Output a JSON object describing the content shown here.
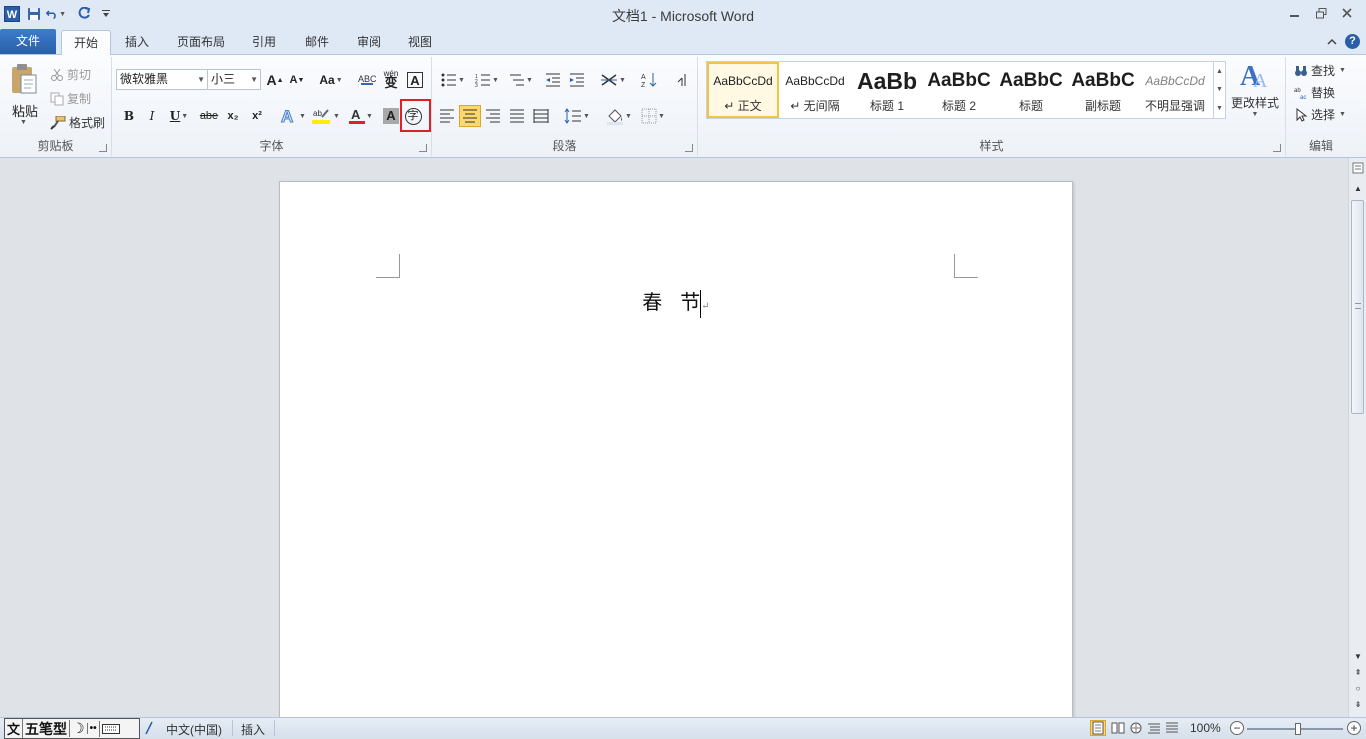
{
  "window": {
    "title": "文档1 - Microsoft Word",
    "app_icon_letter": "W"
  },
  "tabs": [
    {
      "label": "文件"
    },
    {
      "label": "开始"
    },
    {
      "label": "插入"
    },
    {
      "label": "页面布局"
    },
    {
      "label": "引用"
    },
    {
      "label": "邮件"
    },
    {
      "label": "审阅"
    },
    {
      "label": "视图"
    }
  ],
  "clipboard": {
    "paste": "粘贴",
    "cut": "剪切",
    "copy": "复制",
    "format_painter": "格式刷",
    "group_label": "剪贴板"
  },
  "font": {
    "font_name": "微软雅黑",
    "font_size": "小三",
    "group_label": "字体",
    "bold": "B",
    "italic": "I",
    "underline": "U",
    "strike": "abe",
    "subscript": "x₂",
    "superscript": "x²",
    "grow": "A",
    "shrink": "A",
    "change_case": "Aa",
    "phonetic": "wén",
    "char_border": "A",
    "char_shading": "A",
    "enclose": "字"
  },
  "paragraph": {
    "group_label": "段落"
  },
  "styles": {
    "group_label": "样式",
    "items": [
      {
        "sample": "AaBbCcDd",
        "name": "↵ 正文"
      },
      {
        "sample": "AaBbCcDd",
        "name": "↵ 无间隔"
      },
      {
        "sample": "AaBb",
        "name": "标题 1"
      },
      {
        "sample": "AaBbC",
        "name": "标题 2"
      },
      {
        "sample": "AaBbC",
        "name": "标题"
      },
      {
        "sample": "AaBbC",
        "name": "副标题"
      },
      {
        "sample": "AaBbCcDd",
        "name": "不明显强调"
      }
    ],
    "change_styles": "更改样式"
  },
  "editing": {
    "find": "查找",
    "replace": "替换",
    "select": "选择",
    "group_label": "编辑"
  },
  "document": {
    "text": "春节",
    "paragraph_mark": "↵"
  },
  "statusbar": {
    "ime": {
      "mode": "五笔型"
    },
    "language": "中文(中国)",
    "insert_mode": "插入",
    "zoom": "100%"
  },
  "colors": {
    "accent": "#2a5fa8",
    "highlight_box": "#e21e26",
    "selected_style": "#f2c443"
  }
}
